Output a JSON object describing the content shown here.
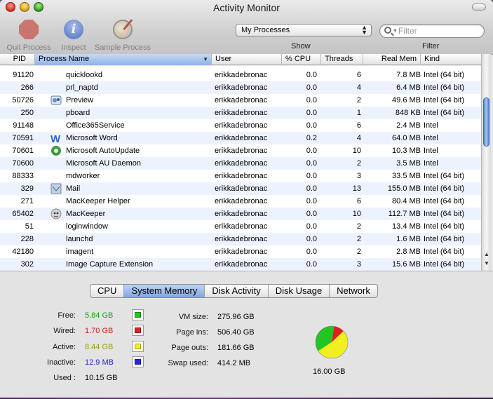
{
  "window": {
    "title": "Activity Monitor"
  },
  "toolbar": {
    "quit_label": "Quit Process",
    "inspect_label": "Inspect",
    "sample_label": "Sample Process",
    "show_label": "Show",
    "show_selected": "My Processes",
    "filter_label": "Filter",
    "filter_placeholder": "Filter"
  },
  "columns": {
    "pid": "PID",
    "name": "Process Name",
    "user": "User",
    "cpu": "% CPU",
    "threads": "Threads",
    "mem": "Real Mem",
    "kind": "Kind"
  },
  "processes": [
    {
      "pid": "91120",
      "name": "quicklookd",
      "icon": "",
      "user": "erikkadebronac",
      "cpu": "0.0",
      "threads": "6",
      "mem": "7.8 MB",
      "kind": "Intel (64 bit)"
    },
    {
      "pid": "266",
      "name": "prl_naptd",
      "icon": "",
      "user": "erikkadebronac",
      "cpu": "0.0",
      "threads": "4",
      "mem": "6.4 MB",
      "kind": "Intel (64 bit)"
    },
    {
      "pid": "50726",
      "name": "Preview",
      "icon": "preview-icon",
      "user": "erikkadebronac",
      "cpu": "0.0",
      "threads": "2",
      "mem": "49.6 MB",
      "kind": "Intel (64 bit)"
    },
    {
      "pid": "250",
      "name": "pboard",
      "icon": "",
      "user": "erikkadebronac",
      "cpu": "0.0",
      "threads": "1",
      "mem": "848 KB",
      "kind": "Intel (64 bit)"
    },
    {
      "pid": "91148",
      "name": "Office365Service",
      "icon": "",
      "user": "erikkadebronac",
      "cpu": "0.0",
      "threads": "6",
      "mem": "2.4 MB",
      "kind": "Intel"
    },
    {
      "pid": "70591",
      "name": "Microsoft Word",
      "icon": "word-icon",
      "user": "erikkadebronac",
      "cpu": "0.2",
      "threads": "4",
      "mem": "64.0 MB",
      "kind": "Intel"
    },
    {
      "pid": "70601",
      "name": "Microsoft AutoUpdate",
      "icon": "autoupdate-icon",
      "user": "erikkadebronac",
      "cpu": "0.0",
      "threads": "10",
      "mem": "10.3 MB",
      "kind": "Intel"
    },
    {
      "pid": "70600",
      "name": "Microsoft AU Daemon",
      "icon": "",
      "user": "erikkadebronac",
      "cpu": "0.0",
      "threads": "2",
      "mem": "3.5 MB",
      "kind": "Intel"
    },
    {
      "pid": "88333",
      "name": "mdworker",
      "icon": "",
      "user": "erikkadebronac",
      "cpu": "0.0",
      "threads": "3",
      "mem": "33.5 MB",
      "kind": "Intel (64 bit)"
    },
    {
      "pid": "329",
      "name": "Mail",
      "icon": "mail-icon",
      "user": "erikkadebronac",
      "cpu": "0.0",
      "threads": "13",
      "mem": "155.0 MB",
      "kind": "Intel (64 bit)"
    },
    {
      "pid": "271",
      "name": "MacKeeper Helper",
      "icon": "",
      "user": "erikkadebronac",
      "cpu": "0.0",
      "threads": "6",
      "mem": "80.4 MB",
      "kind": "Intel (64 bit)"
    },
    {
      "pid": "65402",
      "name": "MacKeeper",
      "icon": "mackeeper-icon",
      "user": "erikkadebronac",
      "cpu": "0.0",
      "threads": "10",
      "mem": "112.7 MB",
      "kind": "Intel (64 bit)"
    },
    {
      "pid": "51",
      "name": "loginwindow",
      "icon": "",
      "user": "erikkadebronac",
      "cpu": "0.0",
      "threads": "2",
      "mem": "13.4 MB",
      "kind": "Intel (64 bit)"
    },
    {
      "pid": "228",
      "name": "launchd",
      "icon": "",
      "user": "erikkadebronac",
      "cpu": "0.0",
      "threads": "2",
      "mem": "1.6 MB",
      "kind": "Intel (64 bit)"
    },
    {
      "pid": "42180",
      "name": "imagent",
      "icon": "",
      "user": "erikkadebronac",
      "cpu": "0.0",
      "threads": "2",
      "mem": "2.8 MB",
      "kind": "Intel (64 bit)"
    },
    {
      "pid": "302",
      "name": "Image Capture Extension",
      "icon": "",
      "user": "erikkadebronac",
      "cpu": "0.0",
      "threads": "3",
      "mem": "15.6 MB",
      "kind": "Intel (64 bit)"
    }
  ],
  "tabs": [
    "CPU",
    "System Memory",
    "Disk Activity",
    "Disk Usage",
    "Network"
  ],
  "active_tab": "System Memory",
  "memory": {
    "free_label": "Free:",
    "free_value": "5.84 GB",
    "free_color": "#22c522",
    "wired_label": "Wired:",
    "wired_value": "1.70 GB",
    "wired_color": "#e02020",
    "active_label": "Active:",
    "active_value": "8.44 GB",
    "active_color": "#f2ef20",
    "inactive_label": "Inactive:",
    "inactive_value": "12.9 MB",
    "inactive_color": "#2222e8",
    "used_label": "Used :",
    "used_value": "10.15 GB",
    "vm_label": "VM size:",
    "vm_value": "275.96 GB",
    "pageins_label": "Page ins:",
    "pageins_value": "506.40 GB",
    "pageouts_label": "Page outs:",
    "pageouts_value": "181.66 GB",
    "swap_label": "Swap used:",
    "swap_value": "414.2 MB",
    "total": "16.00 GB"
  }
}
